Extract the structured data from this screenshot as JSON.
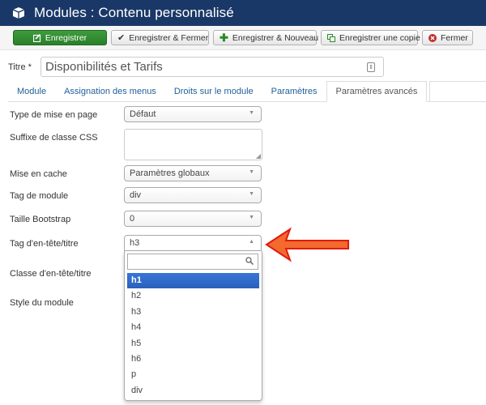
{
  "header": {
    "title": "Modules : Contenu personnalisé",
    "icon": "cube-icon"
  },
  "toolbar": {
    "buttons": [
      {
        "label": "Enregistrer",
        "icon": "edit-icon"
      },
      {
        "label": "Enregistrer & Fermer",
        "icon": "check-icon"
      },
      {
        "label": "Enregistrer & Nouveau",
        "icon": "plus-icon"
      },
      {
        "label": "Enregistrer une copie",
        "icon": "copy-icon"
      },
      {
        "label": "Fermer",
        "icon": "cancel-icon"
      }
    ]
  },
  "title_field": {
    "label": "Titre *",
    "value": "Disponibilités et Tarifs"
  },
  "tabs": [
    {
      "label": "Module"
    },
    {
      "label": "Assignation des menus"
    },
    {
      "label": "Droits sur le module"
    },
    {
      "label": "Paramètres"
    },
    {
      "label": "Paramètres avancés",
      "active": true
    }
  ],
  "form": {
    "layout": {
      "label": "Type de mise en page",
      "value": "Défaut"
    },
    "css_suffix": {
      "label": "Suffixe de classe CSS",
      "value": ""
    },
    "cache": {
      "label": "Mise en cache",
      "value": "Paramètres globaux"
    },
    "module_tag": {
      "label": "Tag de module",
      "value": "div"
    },
    "bootstrap_size": {
      "label": "Taille Bootstrap",
      "value": "0"
    },
    "header_tag": {
      "label": "Tag d'en-tête/titre",
      "value": "h3"
    },
    "header_class": {
      "label": "Classe d'en-tête/titre"
    },
    "module_style": {
      "label": "Style du module"
    }
  },
  "dropdown": {
    "search_value": "",
    "highlighted": "h1",
    "options": [
      "h1",
      "h2",
      "h3",
      "h4",
      "h5",
      "h6",
      "p",
      "div"
    ]
  },
  "annotation": {
    "arrow_color": "#e8401c"
  }
}
